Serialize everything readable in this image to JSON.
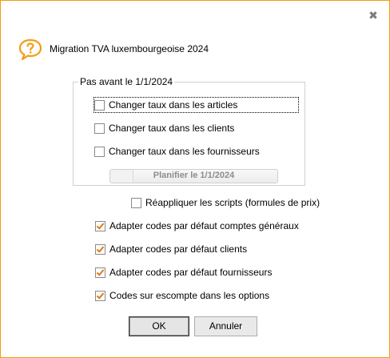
{
  "dialog": {
    "title": "Migration TVA luxembourgeoise 2024",
    "close_glyph": "✖",
    "title_icon": "question-speech-bubble-icon"
  },
  "group": {
    "legend": "Pas avant le 1/1/2024",
    "options": [
      {
        "label": "Changer taux dans les articles",
        "checked": false
      },
      {
        "label": "Changer taux dans les clients",
        "checked": false
      },
      {
        "label": "Changer taux dans les fournisseurs",
        "checked": false
      }
    ],
    "schedule_button": "Planifier le 1/1/2024"
  },
  "reapply_scripts": {
    "label": "Réappliquer les scripts (formules de prix)",
    "checked": false
  },
  "defaults": [
    {
      "label": "Adapter codes par défaut comptes généraux",
      "checked": true
    },
    {
      "label": "Adapter codes par défaut clients",
      "checked": true
    },
    {
      "label": "Adapter codes par défaut fournisseurs",
      "checked": true
    },
    {
      "label": "Codes sur escompte dans les options",
      "checked": true
    }
  ],
  "buttons": {
    "ok": "OK",
    "cancel": "Annuler"
  },
  "colors": {
    "accent": "#f39c12",
    "check": "#e07a10"
  }
}
